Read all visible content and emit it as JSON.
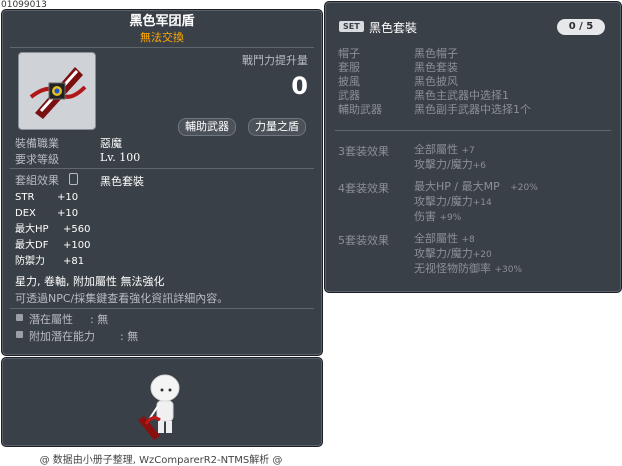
{
  "item_id": "01099013",
  "item": {
    "name": "黑色军团盾",
    "trade_note": "無法交換",
    "power_label": "戰鬥力提升量",
    "power_value": "0",
    "tag_secondary": "輔助武器",
    "tag_shield": "力量之盾",
    "job_label": "裝備職業",
    "job_value": "惡魔",
    "level_label": "要求等級",
    "level_value": "Lv. 100",
    "set_effect_label": "套組效果",
    "set_effect_value": "黑色套裝",
    "stats": [
      {
        "key": "STR",
        "value": "+10"
      },
      {
        "key": "DEX",
        "value": "+10"
      },
      {
        "key": "最大HP",
        "value": "+560"
      },
      {
        "key": "最大DF",
        "value": "+100"
      },
      {
        "key": "防禦力",
        "value": "+81"
      }
    ],
    "enhance_line": "星力, 卷軸, 附加屬性 無法強化",
    "info_line": "可透過NPC/採集鍵查看強化資訊詳細內容。",
    "potential_label": "潛在屬性",
    "potential_value": ": 無",
    "add_potential_label": "附加潛在能力",
    "add_potential_value": ": 無"
  },
  "set": {
    "badge": "SET",
    "title": "黑色套裝",
    "count": "0 / 5",
    "parts": [
      {
        "label": "帽子",
        "value": "黑色帽子"
      },
      {
        "label": "套服",
        "value": "黑色套装"
      },
      {
        "label": "披風",
        "value": "黑色披风"
      },
      {
        "label": "武器",
        "value": "黑色主武器中选择1"
      },
      {
        "label": "輔助武器",
        "value": "黑色副手武器中选择1个"
      }
    ],
    "bonuses": [
      {
        "label": "3套装效果",
        "lines": [
          {
            "text": "全部屬性",
            "value": "+7"
          },
          {
            "text": "攻擊力/魔力",
            "value": "+6"
          }
        ]
      },
      {
        "label": "4套装效果",
        "lines": [
          {
            "text": "最大HP / 最大MP",
            "value": "+20%"
          },
          {
            "text": "攻擊力/魔力",
            "value": "+14"
          },
          {
            "text": "伤害",
            "value": "+9%"
          }
        ]
      },
      {
        "label": "5套装效果",
        "lines": [
          {
            "text": "全部屬性",
            "value": "+8"
          },
          {
            "text": "攻擊力/魔力",
            "value": "+20"
          },
          {
            "text": "无视怪物防御率",
            "value": "+30%"
          }
        ]
      }
    ]
  },
  "footer": "@ 数据由小册子整理, WzComparerR2-NTMS解析 @",
  "colors": {
    "panel": "#3a4047",
    "orange": "#ffaa00",
    "white": "#ffffff"
  }
}
